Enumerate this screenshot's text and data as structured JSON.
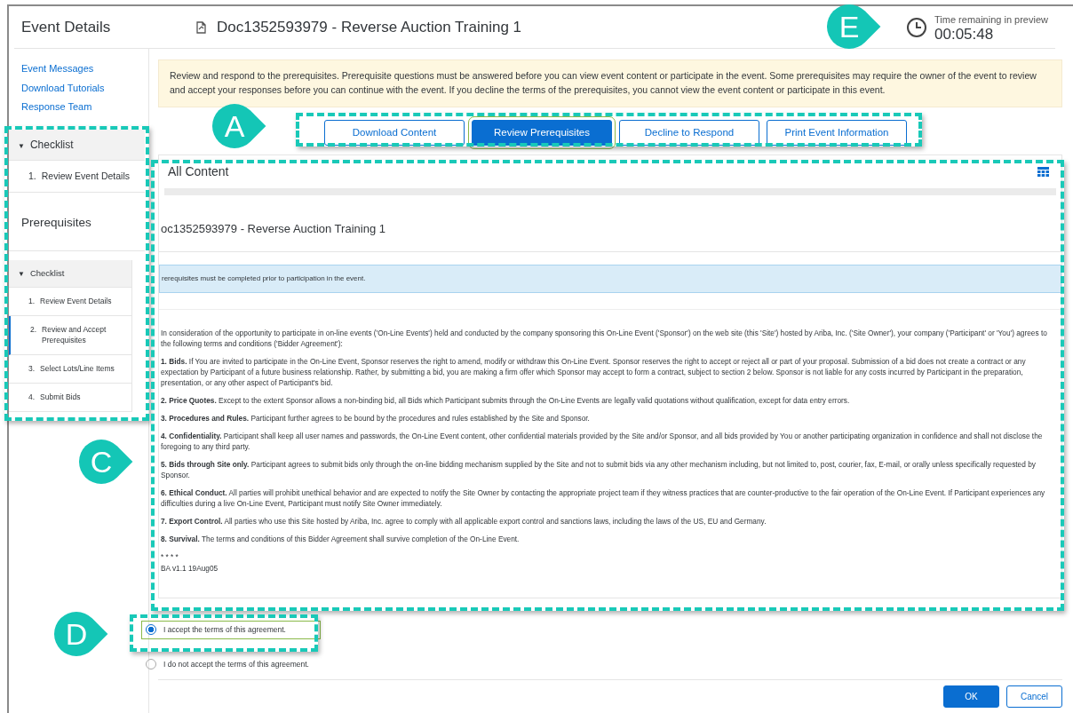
{
  "header": {
    "title": "Event Details",
    "doc_title": "Doc1352593979 - Reverse Auction Training 1",
    "timer_label": "Time remaining in preview",
    "timer_value": "00:05:48"
  },
  "sidebar": {
    "links": [
      "Event Messages",
      "Download Tutorials",
      "Response Team"
    ],
    "checklist": {
      "caret": "▼",
      "title": "Checklist",
      "expanded": true,
      "items": [
        {
          "number": "1.",
          "label": "Review Event Details",
          "selected": false
        }
      ]
    },
    "prerequisites_title": "Prerequisites",
    "sub_checklist": {
      "caret": "▼",
      "title": "Checklist",
      "expanded": true,
      "items": [
        {
          "number": "1.",
          "label": "Review Event Details",
          "selected": false
        },
        {
          "number": "2.",
          "label": "Review and Accept Prerequisites",
          "selected": true
        },
        {
          "number": "3.",
          "label": "Select Lots/Line Items",
          "selected": false
        },
        {
          "number": "4.",
          "label": "Submit Bids",
          "selected": false
        }
      ]
    }
  },
  "notice": "Review and respond to the prerequisites. Prerequisite questions must be answered before you can view event content or participate in the event. Some prerequisites may require the owner of the event to review and accept your responses before you can continue with the event. If you decline the terms of the prerequisites, you cannot view the event content or participate in this event.",
  "buttons": [
    {
      "label": "Download Content",
      "selected": false
    },
    {
      "label": "Review Prerequisites",
      "selected": true
    },
    {
      "label": "Decline to Respond",
      "selected": false
    },
    {
      "label": "Print Event Information",
      "selected": false
    }
  ],
  "content": {
    "title": "All Content",
    "doc_title": "oc1352593979 - Reverse Auction Training 1",
    "info": "rerequisites must be completed prior to participation in the event.",
    "terms": [
      "In consideration of the opportunity to participate in on-line events ('On-Line Events') held and conducted by the company sponsoring this On-Line Event ('Sponsor') on the web site (this 'Site') hosted by Ariba, Inc. ('Site Owner'), your company ('Participant' or 'You') agrees to the following terms and conditions ('Bidder Agreement'):",
      "**1. Bids.** If You are invited to participate in the On-Line Event, Sponsor reserves the right to amend, modify or withdraw this On-Line Event. Sponsor reserves the right to accept or reject all or part of your proposal. Submission of a bid does not create a contract or any expectation by Participant of a future business relationship. Rather, by submitting a bid, you are making a firm offer which Sponsor may accept to form a contract, subject to section 2 below. Sponsor is not liable for any costs incurred by Participant in the preparation, presentation, or any other aspect of Participant's bid.",
      "**2. Price Quotes.** Except to the extent Sponsor allows a non-binding bid, all Bids which Participant submits through the On-Line Events are legally valid quotations without qualification, except for data entry errors.",
      "**3. Procedures and Rules.** Participant further agrees to be bound by the procedures and rules established by the Site and Sponsor.",
      "**4. Confidentiality.** Participant shall keep all user names and passwords, the On-Line Event content, other confidential materials provided by the Site and/or Sponsor, and all bids provided by You or another participating organization in confidence and shall not disclose the foregoing to any third party.",
      "**5. Bids through Site only.** Participant agrees to submit bids only through the on-line bidding mechanism supplied by the Site and not to submit bids via any other mechanism including, but not limited to, post, courier, fax, E-mail, or orally unless specifically requested by Sponsor.",
      "**6. Ethical Conduct.** All parties will prohibit unethical behavior and are expected to notify the Site Owner by contacting the appropriate project team if they witness practices that are counter-productive to the fair operation of the On-Line Event. If Participant experiences any difficulties during a live On-Line Event, Participant must notify Site Owner immediately.",
      "**7. Export Control.** All parties who use this Site hosted by Ariba, Inc. agree to comply with all applicable export control and sanctions laws, including the laws of the US, EU and Germany.",
      "**8. Survival.** The terms and conditions of this Bidder Agreement shall survive completion of the On-Line Event."
    ],
    "separator": "* * * *",
    "version": "BA v1.1 19Aug05"
  },
  "options": [
    {
      "label": "I accept the terms of this agreement.",
      "selected": true
    },
    {
      "label": "I do not accept the terms of this agreement.",
      "selected": false
    }
  ],
  "actions": [
    {
      "label": "OK",
      "kind": "primary"
    },
    {
      "label": "Cancel",
      "kind": "secondary"
    }
  ],
  "callouts": [
    {
      "label": "A"
    },
    {
      "label": "C"
    },
    {
      "label": "D"
    },
    {
      "label": "E"
    }
  ]
}
